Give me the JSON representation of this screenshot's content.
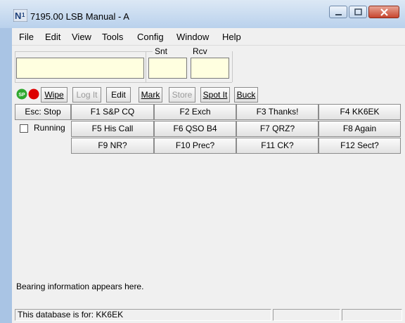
{
  "window": {
    "title": "7195.00 LSB Manual - A"
  },
  "menu": [
    "File",
    "Edit",
    "View",
    "Tools",
    "Config",
    "Window",
    "Help"
  ],
  "entry": {
    "call_value": "",
    "snt_label": "Snt",
    "snt_value": "",
    "rcv_label": "Rcv",
    "rcv_value": ""
  },
  "indicators": {
    "sp_badge": "SP"
  },
  "toolbar": {
    "wipe": "Wipe",
    "logit": "Log It",
    "edit": "Edit",
    "mark": "Mark",
    "store": "Store",
    "spotit": "Spot It",
    "buck": "Buck"
  },
  "controls": {
    "esc_stop": "Esc: Stop",
    "running_label": "Running",
    "running_checked": false
  },
  "function_keys": {
    "row1": [
      "F1 S&P CQ",
      "F2 Exch",
      "F3 Thanks!",
      "F4 KK6EK"
    ],
    "row2": [
      "F5 His Call",
      "F6 QSO B4",
      "F7 QRZ?",
      "F8 Again"
    ],
    "row3": [
      "F9 NR?",
      "F10 Prec?",
      "F11 CK?",
      "F12 Sect?"
    ]
  },
  "bearing_text": "Bearing information appears here.",
  "status": {
    "database": "This database is for: KK6EK"
  },
  "colors": {
    "entry_bg": "#ffffe0",
    "record_red": "#dd0000",
    "sp_green": "#2fa82f"
  }
}
